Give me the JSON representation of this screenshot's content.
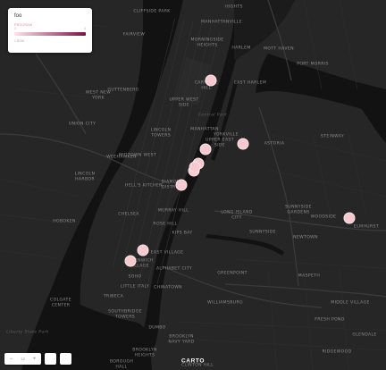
{
  "map": {
    "labels": [
      {
        "text": "CLIFFSIDE PARK"
      },
      {
        "text": "HIGHTS"
      },
      {
        "text": "MANHATTANVILLE"
      },
      {
        "text": "FAIRVIEW"
      },
      {
        "text": "MORNINGSIDE\nHEIGHTS"
      },
      {
        "text": "HARLEM"
      },
      {
        "text": "MOTT HAVEN"
      },
      {
        "text": "PORT MORRIS"
      },
      {
        "text": "GUTTENBERG"
      },
      {
        "text": "WEST NEW\nYORK"
      },
      {
        "text": "CARNEGIE\nHILL"
      },
      {
        "text": "UPPER WEST\nSIDE"
      },
      {
        "text": "EAST HARLEM"
      },
      {
        "text": "UNION CITY"
      },
      {
        "text": "LINCOLN\nTOWERS"
      },
      {
        "text": "MANHATTAN"
      },
      {
        "text": "YORKVILLE"
      },
      {
        "text": "UPPER EAST\nSIDE"
      },
      {
        "text": "ASTORIA"
      },
      {
        "text": "STEINWAY"
      },
      {
        "text": "MIDTOWN WEST"
      },
      {
        "text": "WEEHAWKEN"
      },
      {
        "text": "LINCOLN\nHARBOR"
      },
      {
        "text": "HELL'S KITCHEN"
      },
      {
        "text": "DIAMOND\nDISTRICT"
      },
      {
        "text": "CHELSEA"
      },
      {
        "text": "MURRAY HILL"
      },
      {
        "text": "ROSE HILL"
      },
      {
        "text": "KIPS BAY"
      },
      {
        "text": "LONG ISLAND\nCITY"
      },
      {
        "text": "SUNNYSIDE\nGARDENS"
      },
      {
        "text": "WOODSIDE"
      },
      {
        "text": "ELMHURST"
      },
      {
        "text": "HOBOKEN"
      },
      {
        "text": "SUNNYSIDE"
      },
      {
        "text": "NEWTOWN"
      },
      {
        "text": "GREENWICH\nVILLAGE"
      },
      {
        "text": "EAST VILLAGE"
      },
      {
        "text": "ALPHABET CITY"
      },
      {
        "text": "SOHO"
      },
      {
        "text": "LITTLE ITALY"
      },
      {
        "text": "CHINATOWN"
      },
      {
        "text": "GREENPOINT"
      },
      {
        "text": "TRIBECA"
      },
      {
        "text": "MASPETH"
      },
      {
        "text": "COLGATE\nCENTER"
      },
      {
        "text": "SOUTHBRIDGE\nTOWERS"
      },
      {
        "text": "WILLIAMSBURG"
      },
      {
        "text": "MIDDLE VILLAGE"
      },
      {
        "text": "DUMBO"
      },
      {
        "text": "BROOKLYN\nNAVY YARD"
      },
      {
        "text": "FRESH POND"
      },
      {
        "text": "BROOKLYN\nHEIGHTS"
      },
      {
        "text": "CLINTON HILL"
      },
      {
        "text": "GLENDALE"
      },
      {
        "text": "BOROUGH\nHALL"
      },
      {
        "text": "RIDGEWOOD"
      },
      {
        "text": "Liberty State Park",
        "water": true
      },
      {
        "text": "Central Park",
        "water": true
      }
    ],
    "points": [
      {
        "name": "Carnegie Hill"
      },
      {
        "name": "Upper East Side"
      },
      {
        "name": "Astoria"
      },
      {
        "name": "Midtown East"
      },
      {
        "name": "Midtown"
      },
      {
        "name": "Midtown South"
      },
      {
        "name": "Diamond District"
      },
      {
        "name": "Woodside"
      },
      {
        "name": "East Village"
      },
      {
        "name": "Greenwich Village"
      }
    ]
  },
  "legend": {
    "title": "foo",
    "field": "PROGRAM",
    "tick_min": "1",
    "tick_max": "1",
    "note": "1 ROW",
    "gradient_start": "#fce4ea",
    "gradient_end": "#7a1145"
  },
  "controls": {
    "zoom_out": "−",
    "zoom_level": "12",
    "zoom_in": "+",
    "logo": "CARTO"
  },
  "colors": {
    "land": "#262626",
    "water": "#121212",
    "point": "#f6c9d0"
  }
}
